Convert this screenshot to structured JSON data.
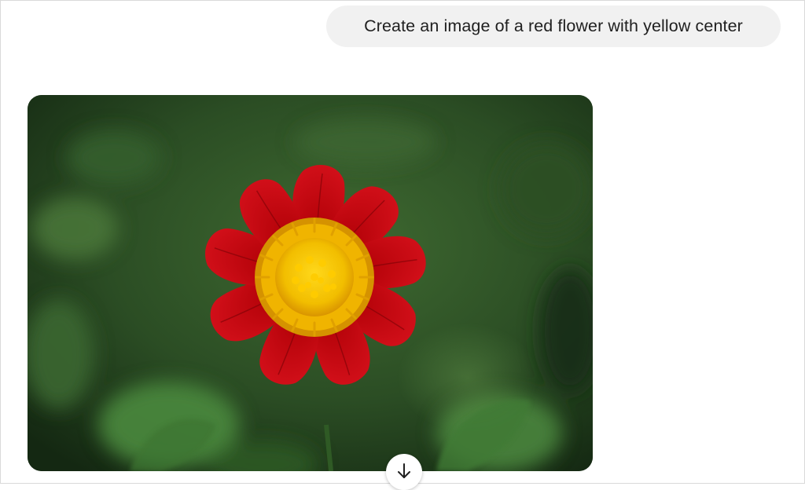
{
  "conversation": {
    "user_prompt": "Create an image of a red flower with yellow center"
  },
  "generated_image": {
    "subject": "red flower with yellow center",
    "colors": {
      "background_dark": "#1f3a1c",
      "background_light": "#4f7a3e",
      "petal": "#c4050c",
      "petal_dark": "#8a0208",
      "center": "#f6c200",
      "center_ring": "#e9a500"
    }
  },
  "actions": {
    "download_icon": "arrow-down-icon"
  }
}
